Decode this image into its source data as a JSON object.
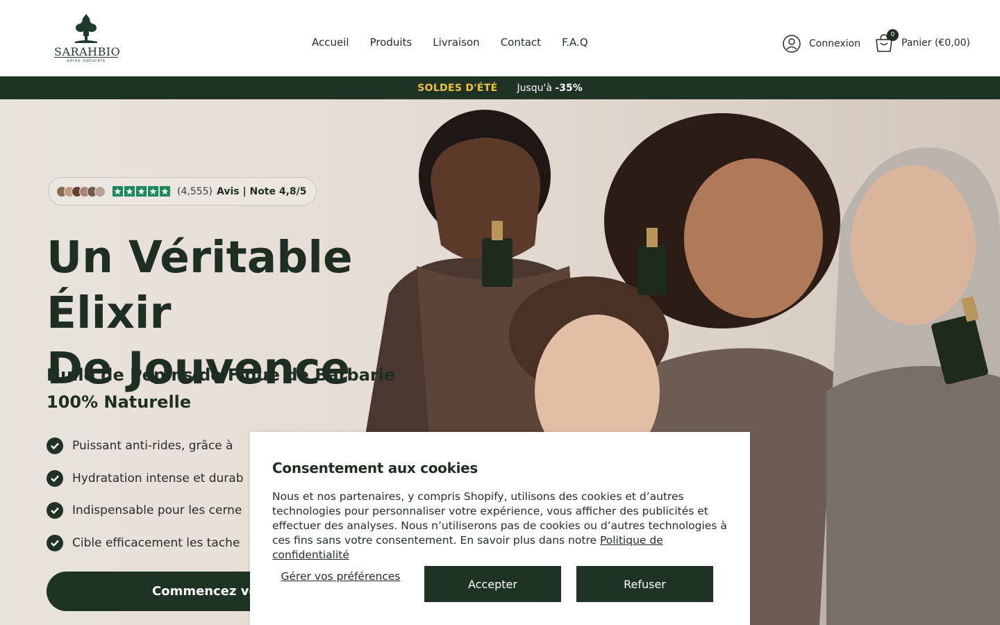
{
  "brand": {
    "logo_text": "SARAHBIO",
    "logo_tagline": "soins naturels"
  },
  "nav": {
    "items": [
      {
        "label": "Accueil"
      },
      {
        "label": "Produits"
      },
      {
        "label": "Livraison"
      },
      {
        "label": "Contact"
      },
      {
        "label": "F.A.Q"
      }
    ]
  },
  "header": {
    "login_label": "Connexion",
    "cart_label": "Panier (€0,00)",
    "cart_count": "0"
  },
  "promo": {
    "badge": "SOLDES D'ÉTÉ",
    "text_prefix": "Jusqu'à ",
    "text_value": "-35%"
  },
  "hero": {
    "reviews_count": "(4,555)",
    "reviews_note": "Avis | Note 4,8/5",
    "rating_stars": 5,
    "title_line1": "Un Véritable Élixir",
    "title_line2": "De Jouvence",
    "subtitle": "Huile de Pépins de Figue de Barbarie 100% Naturelle",
    "benefits": [
      {
        "text": "Puissant anti-rides, grâce à"
      },
      {
        "text": "Hydratation intense et durab"
      },
      {
        "text": "Indispensable pour les cerne"
      },
      {
        "text": "Cible efficacement les tache"
      }
    ],
    "cta_label": "Commencez vo"
  },
  "cookie": {
    "title": "Consentement aux cookies",
    "body": "Nous et nos partenaires, y compris Shopify, utilisons des cookies et d’autres technologies pour personnaliser votre expérience, vous afficher des publicités et effectuer des analyses. Nous n’utiliserons pas de cookies ou d’autres technologies à ces fins sans votre consentement. En savoir plus dans notre ",
    "policy_link": "Politique de confidentialité",
    "manage_label": "Gérer vos préférences",
    "accept_label": "Accepter",
    "refuse_label": "Refuser"
  },
  "colors": {
    "primary_dark_green": "#1f3324",
    "promo_yellow": "#f0c142",
    "star_green": "#1b8a5a"
  }
}
